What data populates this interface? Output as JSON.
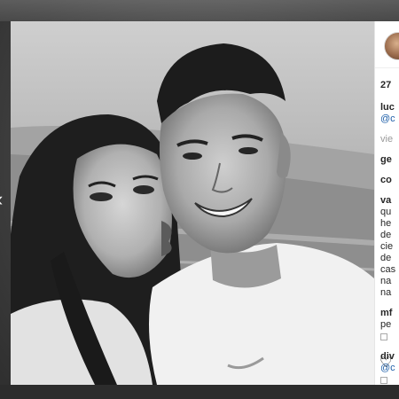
{
  "post": {
    "time_short": "27",
    "caption_user": "luc",
    "caption_mention": "@c",
    "view_link": "vie",
    "comments": [
      {
        "user": "ge",
        "text": ""
      },
      {
        "user": "co",
        "text": ""
      },
      {
        "user": "va",
        "lines": [
          "qu",
          "he",
          "de",
          "cie",
          "de",
          "cas",
          "na",
          "na"
        ]
      },
      {
        "user": "mf",
        "lines": [
          "pe"
        ]
      },
      {
        "user": "div",
        "lines": [
          "@c"
        ]
      }
    ]
  },
  "icons": {
    "close": "chevron-left-icon",
    "like": "heart-icon",
    "avatar": "avatar"
  }
}
